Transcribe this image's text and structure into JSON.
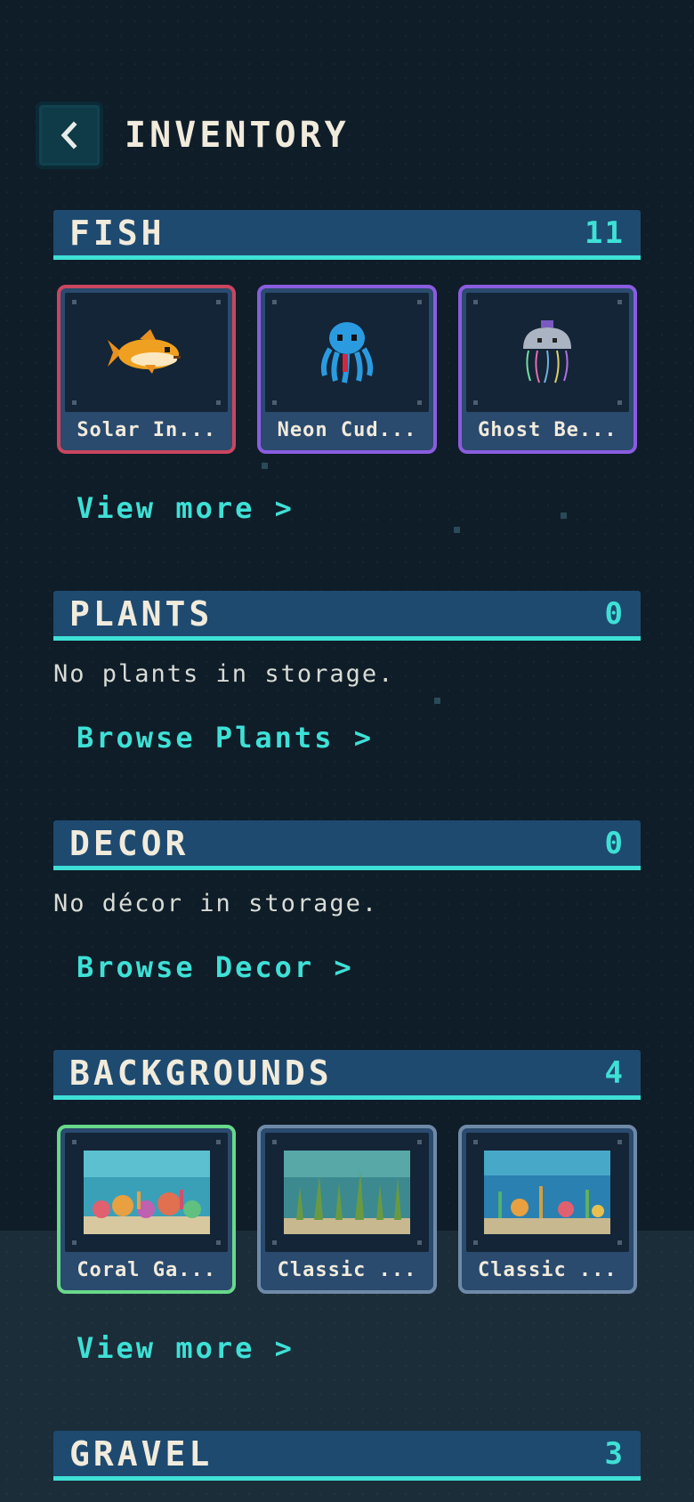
{
  "header": {
    "title": "INVENTORY",
    "back_icon": "chevron-left-icon"
  },
  "fish": {
    "title": "FISH",
    "count": "11",
    "items": [
      {
        "label": "Solar In...",
        "icon": "orange-fish-icon",
        "border_color": "#c9465e"
      },
      {
        "label": "Neon Cud...",
        "icon": "blue-octopus-icon",
        "border_color": "#8a5ce0"
      },
      {
        "label": "Ghost Be...",
        "icon": "jellyfish-icon",
        "border_color": "#8a5ce0"
      }
    ],
    "link": "View more >"
  },
  "plants": {
    "title": "PLANTS",
    "count": "0",
    "empty": "No plants in storage.",
    "link": "Browse Plants >"
  },
  "decor": {
    "title": "DECOR",
    "count": "0",
    "empty": "No décor in storage.",
    "link": "Browse Decor >"
  },
  "backgrounds": {
    "title": "BACKGROUNDS",
    "count": "4",
    "items": [
      {
        "label": "Coral Ga...",
        "icon": "coral-garden-scene-icon",
        "border_color": "#68d88a"
      },
      {
        "label": "Classic ...",
        "icon": "kelp-scene-icon",
        "border_color": "#6f8aa8"
      },
      {
        "label": "Classic ...",
        "icon": "reef-scene-icon",
        "border_color": "#6f8aa8"
      }
    ],
    "link": "View more >"
  },
  "gravel": {
    "title": "GRAVEL",
    "count": "3"
  },
  "colors": {
    "accent": "#3ee0d6",
    "section_bar": "#1e4a70",
    "background": "#0f1d28",
    "title_text": "#f1ebdc"
  }
}
